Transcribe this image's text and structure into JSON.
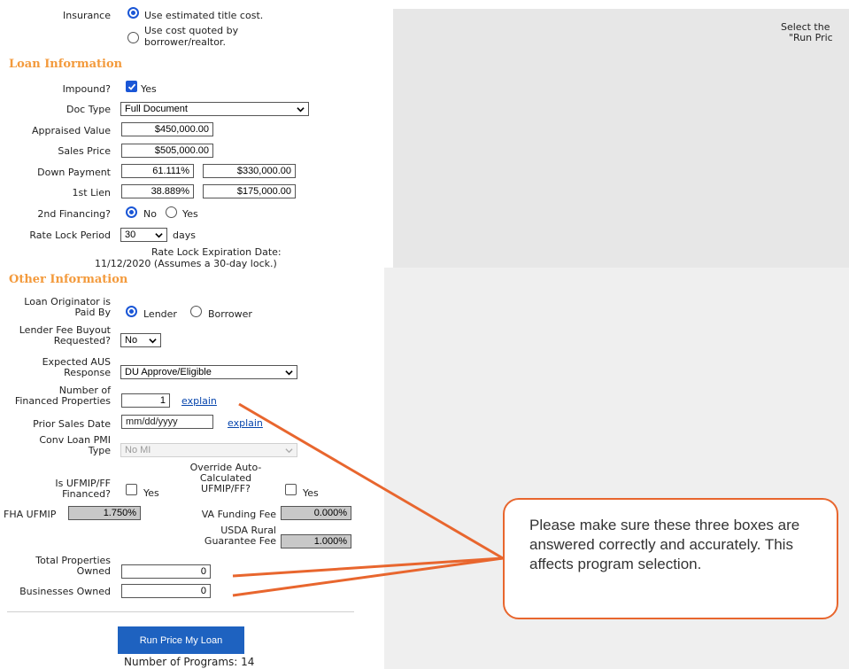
{
  "insurance": {
    "label": "Insurance",
    "option_estimated": "Use estimated title cost.",
    "option_quoted": "Use cost quoted by borrower/realtor."
  },
  "loan_info": {
    "heading": "Loan Information",
    "impound_label": "Impound?",
    "impound_option": "Yes",
    "doc_type_label": "Doc Type",
    "doc_type_value": "Full Document",
    "appraised_label": "Appraised Value",
    "appraised_value": "$450,000.00",
    "sales_price_label": "Sales Price",
    "sales_price_value": "$505,000.00",
    "down_payment_label": "Down Payment",
    "down_payment_pct": "61.111%",
    "down_payment_amt": "$330,000.00",
    "first_lien_label": "1st Lien",
    "first_lien_pct": "38.889%",
    "first_lien_amt": "$175,000.00",
    "second_financing_label": "2nd Financing?",
    "second_financing_no": "No",
    "second_financing_yes": "Yes",
    "rate_lock_label": "Rate Lock Period",
    "rate_lock_value": "30",
    "rate_lock_unit": "days",
    "rate_lock_exp_line1": "Rate Lock Expiration Date:",
    "rate_lock_exp_line2": "11/12/2020 (Assumes a 30-day lock.)"
  },
  "other_info": {
    "heading": "Other Information",
    "lo_paid_label_1": "Loan Originator is",
    "lo_paid_label_2": "Paid By",
    "lo_paid_lender": "Lender",
    "lo_paid_borrower": "Borrower",
    "fee_buyout_label_1": "Lender Fee Buyout",
    "fee_buyout_label_2": "Requested?",
    "fee_buyout_value": "No",
    "aus_label_1": "Expected AUS",
    "aus_label_2": "Response",
    "aus_value": "DU Approve/Eligible",
    "num_fin_label_1": "Number of",
    "num_fin_label_2": "Financed Properties",
    "num_fin_value": "1",
    "explain_link": "explain",
    "prior_sales_label": "Prior Sales Date",
    "prior_sales_placeholder": "mm/dd/yyyy",
    "prior_sales_explain": "explain",
    "pmi_label_1": "Conv Loan PMI",
    "pmi_label_2": "Type",
    "pmi_value": "No MI",
    "ufmip_fin_label_1": "Is UFMIP/FF",
    "ufmip_fin_label_2": "Financed?",
    "ufmip_fin_yes": "Yes",
    "override_label_1": "Override Auto-",
    "override_label_2": "Calculated",
    "override_label_3": "UFMIP/FF?",
    "override_yes": "Yes",
    "fha_label": "FHA UFMIP",
    "fha_value": "1.750%",
    "va_label": "VA Funding Fee",
    "va_value": "0.000%",
    "usda_label_1": "USDA Rural",
    "usda_label_2": "Guarantee Fee",
    "usda_value": "1.000%",
    "total_props_label_1": "Total Properties",
    "total_props_label_2": "Owned",
    "total_props_value": "0",
    "businesses_label": "Businesses Owned",
    "businesses_value": "0"
  },
  "actions": {
    "run_button": "Run Price My Loan",
    "programs_count": "Number of Programs: 14"
  },
  "results_panel": {
    "line1": "Select the",
    "line2": "\"Run Pric"
  },
  "callout": {
    "text": "Please make sure these three boxes are answered correctly and accurately. This affects program selection."
  },
  "colors": {
    "section_heading": "#f39a3c",
    "accent_blue": "#1a56d6",
    "button_blue": "#1e62c0",
    "annotation_orange": "#e8662e"
  }
}
